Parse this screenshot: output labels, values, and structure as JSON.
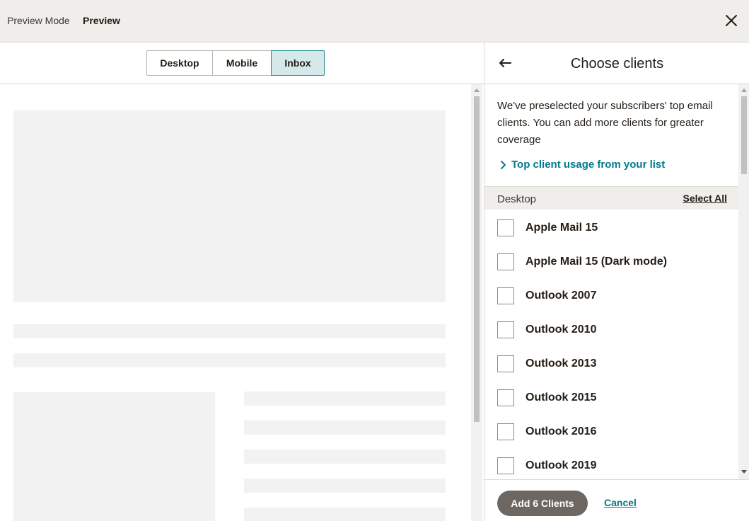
{
  "topbar": {
    "mode_label": "Preview Mode",
    "title": "Preview",
    "close_icon": "close-icon"
  },
  "preview": {
    "tabs": [
      {
        "label": "Desktop",
        "selected": false
      },
      {
        "label": "Mobile",
        "selected": false
      },
      {
        "label": "Inbox",
        "selected": true
      }
    ]
  },
  "panel": {
    "back_icon": "arrow-left-icon",
    "title": "Choose clients",
    "intro": "We've preselected your subscribers' top email clients. You can add more clients for greater coverage",
    "usage_link": "Top client usage from your list",
    "group": {
      "name": "Desktop",
      "select_all": "Select All",
      "clients": [
        {
          "label": "Apple Mail 15",
          "checked": false
        },
        {
          "label": "Apple Mail 15 (Dark mode)",
          "checked": false
        },
        {
          "label": "Outlook 2007",
          "checked": false
        },
        {
          "label": "Outlook 2010",
          "checked": false
        },
        {
          "label": "Outlook 2013",
          "checked": false
        },
        {
          "label": "Outlook 2015",
          "checked": false
        },
        {
          "label": "Outlook 2016",
          "checked": false
        },
        {
          "label": "Outlook 2019",
          "checked": false
        }
      ]
    },
    "footer": {
      "add_label": "Add 6 Clients",
      "cancel_label": "Cancel"
    }
  },
  "colors": {
    "accent": "#007c89",
    "selected_tab_bg": "#d6e9ea",
    "primary_button": "#6e6761"
  }
}
